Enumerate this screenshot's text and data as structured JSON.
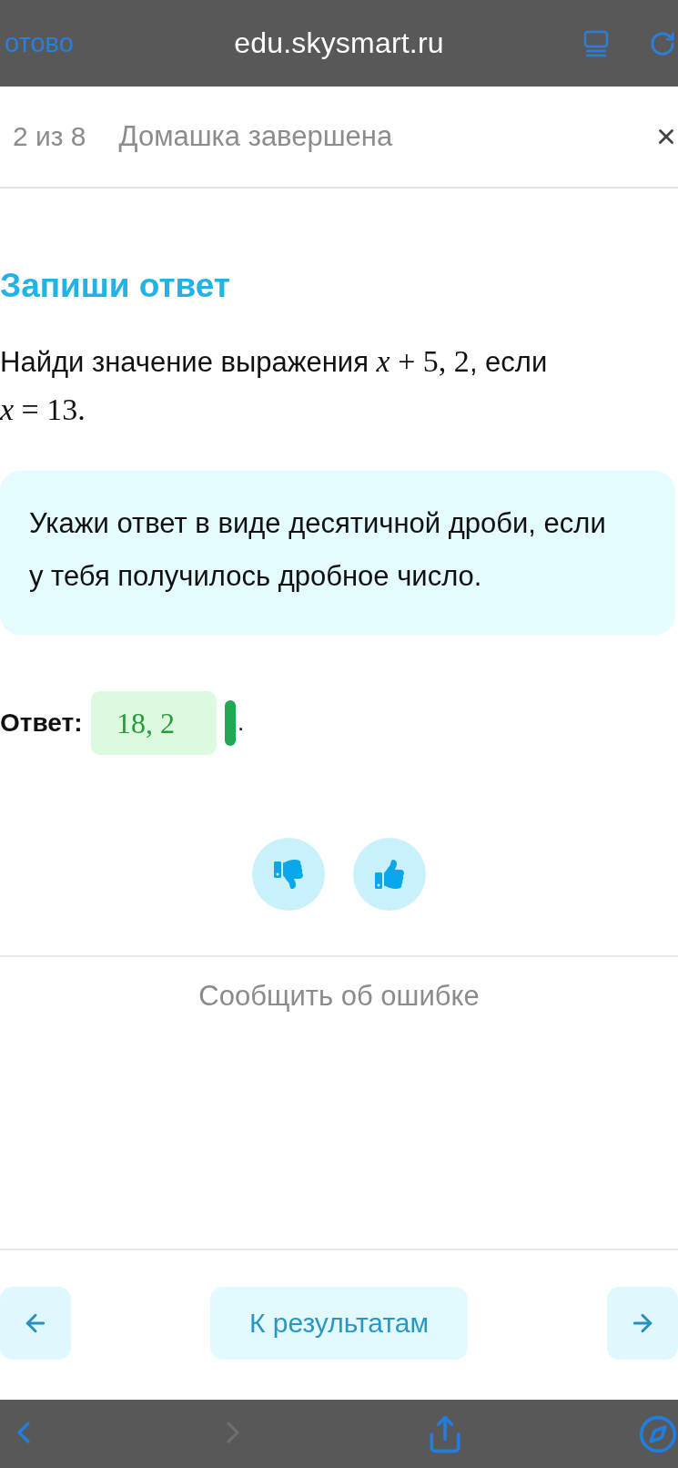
{
  "browser": {
    "done_label": "отово",
    "url": "edu.skysmart.ru"
  },
  "header": {
    "counter": "2 из 8",
    "status": "Домашка завершена"
  },
  "task": {
    "heading": "Запиши ответ",
    "question": [
      {
        "kind": "text",
        "text": "Найди значение выражения "
      },
      {
        "kind": "math",
        "text": "*x* + 5, 2"
      },
      {
        "kind": "text",
        "text": ", если "
      },
      {
        "kind": "math",
        "text": "*x* = 13."
      }
    ],
    "hint": "Укажи ответ в виде десятичной дроби, если у тебя получилось дробное число."
  },
  "answer": {
    "label": "Ответ:",
    "value": "18, 2",
    "correct": true,
    "suffix": "."
  },
  "report_link": "Сообщить об ошибке",
  "navigation": {
    "results_label": "К результатам"
  },
  "browser_toolbar": [
    {
      "kind": "back",
      "disabled": false
    },
    {
      "kind": "forward",
      "disabled": true
    },
    {
      "kind": "share",
      "disabled": false
    },
    {
      "kind": "compass",
      "disabled": false
    }
  ]
}
